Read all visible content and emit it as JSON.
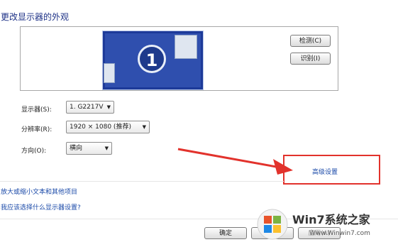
{
  "dialog": {
    "title": "更改显示器的外观",
    "monitor_number": "1",
    "detect_button": "检测(C)",
    "identify_button": "识别(I)"
  },
  "fields": {
    "display_label": "显示器(S):",
    "display_value": "1. G2217V",
    "resolution_label": "分辨率(R):",
    "resolution_value": "1920 × 1080 (推荐)",
    "orientation_label": "方向(O):",
    "orientation_value": "横向"
  },
  "links": {
    "advanced_settings": "高级设置",
    "text_size": "放大或缩小文本和其他项目",
    "help": "我应该选择什么显示器设置?"
  },
  "footer": {
    "ok_button": "确定",
    "cancel_button": "取消",
    "apply_button": "应用(A)"
  },
  "watermark": {
    "brand": "Win7系统之家",
    "url": "Www.Winwin7.com"
  },
  "colors": {
    "accent_red": "#e2322c",
    "title_blue": "#1e3287",
    "link_blue": "#1a49a8",
    "monitor_blue": "#1d3a99"
  }
}
